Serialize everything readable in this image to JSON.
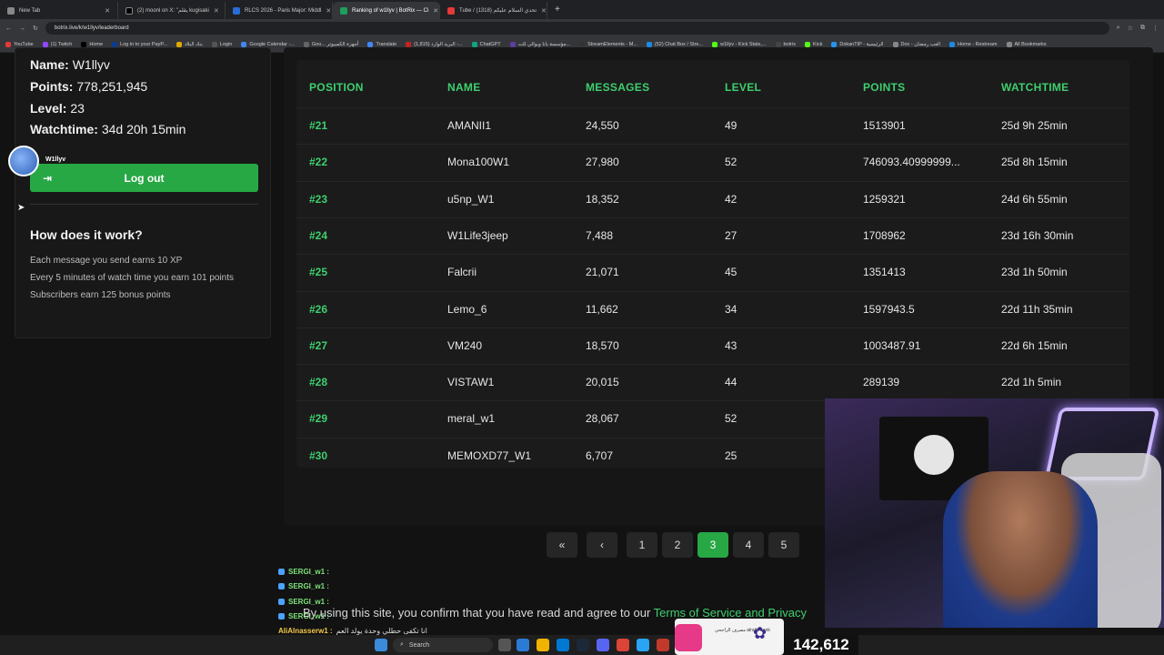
{
  "browser": {
    "tabs": [
      {
        "label": "New Tab",
        "color": "#888888"
      },
      {
        "label": "(2) moonl on X: \"يقلم kugisaki",
        "color": "#000000"
      },
      {
        "label": "RLCS 2026 - Paris Major: Middl",
        "color": "#2a6cd6"
      },
      {
        "label": "Ranking of w1llyv | BotRix — Ci",
        "color": "#1e9e5a"
      },
      {
        "label": "Tube / تحدي السلام عليكم (1318)",
        "color": "#e53935"
      }
    ],
    "url": "botrix.live/k/w1llyv/leaderboard",
    "bookmarks": [
      "YouTube",
      "(1) Twitch",
      "Home",
      "Log in to your PayP...",
      "بنك البلاد",
      "Login",
      "Google Calendar -...",
      "Goo... أجهزة الكمبيوتر",
      "Translate",
      "(1,815) البريد الوارد -...",
      "ChatGPT",
      "مؤسسة بانا وبوالي للت...",
      "StreamElements - M...",
      "(52) Chat Box / Stre...",
      "w1llyv - Kick Stats,...",
      "botrix",
      "Kick",
      "DokanTIP - الرئيسية",
      "Doc - العب رمضان",
      "Home - Restream",
      "All Bookmarks"
    ]
  },
  "profile": {
    "name_label": "Name:",
    "name_value": "W1llyv",
    "points_label": "Points:",
    "points_value": "778,251,945",
    "level_label": "Level:",
    "level_value": "23",
    "watchtime_label": "Watchtime:",
    "watchtime_value": "34d 20h 15min",
    "logout_label": "Log out",
    "avatar_name": "W1llyv"
  },
  "how": {
    "title": "How does it work?",
    "lines": [
      "Each message you send earns 10 XP",
      "Every 5 minutes of watch time you earn 101 points",
      "Subscribers earn 125 bonus points"
    ]
  },
  "leaderboard": {
    "headers": [
      "POSITION",
      "NAME",
      "MESSAGES",
      "LEVEL",
      "POINTS",
      "WATCHTIME"
    ],
    "rows": [
      [
        "#21",
        "AMANII1",
        "24,550",
        "49",
        "1513901",
        "25d 9h 25min"
      ],
      [
        "#22",
        "Mona100W1",
        "27,980",
        "52",
        "746093.40999999...",
        "25d 8h 15min"
      ],
      [
        "#23",
        "u5np_W1",
        "18,352",
        "42",
        "1259321",
        "24d 6h 55min"
      ],
      [
        "#24",
        "W1Life3jeep",
        "7,488",
        "27",
        "1708962",
        "23d 16h 30min"
      ],
      [
        "#25",
        "Falcrii",
        "21,071",
        "45",
        "1351413",
        "23d 1h 50min"
      ],
      [
        "#26",
        "Lemo_6",
        "11,662",
        "34",
        "1597943.5",
        "22d 11h 35min"
      ],
      [
        "#27",
        "VM240",
        "18,570",
        "43",
        "1003487.91",
        "22d 6h 15min"
      ],
      [
        "#28",
        "VISTAW1",
        "20,015",
        "44",
        "289139",
        "22d 1h 5min"
      ],
      [
        "#29",
        "meral_w1",
        "28,067",
        "52",
        "",
        ""
      ],
      [
        "#30",
        "MEMOXD77_W1",
        "6,707",
        "25",
        "",
        ""
      ]
    ]
  },
  "pagination": {
    "first": "«",
    "prev": "‹",
    "pages": [
      "1",
      "2",
      "3",
      "4",
      "5"
    ],
    "current": "3"
  },
  "stream": {
    "chat": [
      {
        "user": "SERGI_w1 :",
        "msg": ""
      },
      {
        "user": "SERGI_w1 :",
        "msg": ""
      },
      {
        "user": "SERGI_w1 :",
        "msg": ""
      },
      {
        "user": "SERGI_w1 :",
        "msg": ""
      },
      {
        "user": "AliAlnasserw1 :",
        "msg": "انا تكفى حطلي وحدة يولد العم"
      }
    ],
    "terms_text": "By using this site, you confirm that you have read and agree to our",
    "terms_link": "Terms of Service and Privacy",
    "counter": "142,612",
    "search_label": "Search",
    "bank_text": "مصرف الراجحي alrajhi bank"
  }
}
